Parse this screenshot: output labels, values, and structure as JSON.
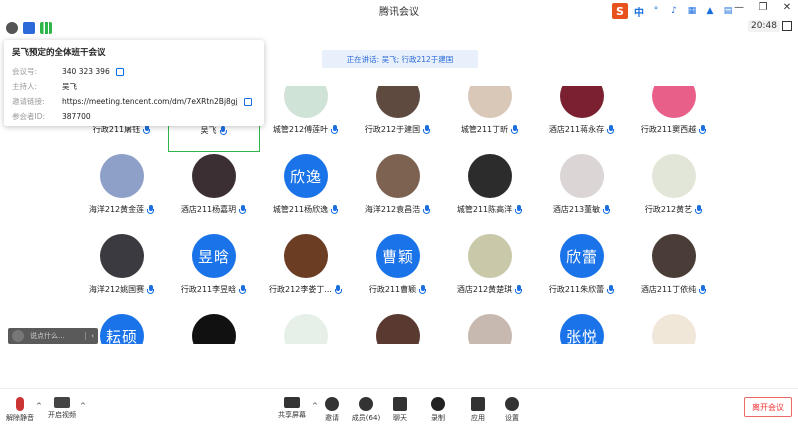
{
  "window": {
    "title": "腾讯会议",
    "minimize": "—",
    "restore": "❐",
    "close": "✕"
  },
  "ime": {
    "logo": "S",
    "lang": "中"
  },
  "status": {
    "clock": "20:48"
  },
  "meeting_info": {
    "title": "吴飞预定的全体班干会议",
    "rows": [
      {
        "label": "会议号:",
        "value": "340 323 396",
        "copy": true
      },
      {
        "label": "主持人:",
        "value": "吴飞",
        "copy": false
      },
      {
        "label": "邀请链接:",
        "value": "https://meeting.tencent.com/dm/7eXRtn2Bj8gj",
        "copy": true
      },
      {
        "label": "参会者ID:",
        "value": "387700",
        "copy": false
      }
    ]
  },
  "speaking": "正在讲话: 吴飞; 行政212于建国",
  "participants": [
    {
      "name": "行政211屠钰",
      "color": "#ccc",
      "partial": true
    },
    {
      "name": "吴飞",
      "color": "#888",
      "partial": true,
      "highlight": true
    },
    {
      "name": "城管212傅莲叶",
      "color": "#cfe3d6"
    },
    {
      "name": "行政212于建国",
      "color": "#5e4a3e"
    },
    {
      "name": "城管211丁昕",
      "color": "#d9c7b8"
    },
    {
      "name": "酒店211蒋永存",
      "color": "#7a2030"
    },
    {
      "name": "行政211窦西越",
      "color": "#e8608a"
    },
    {
      "name": "海洋212黄金莲",
      "color": "#8fa0c8"
    },
    {
      "name": "酒店211杨嘉玥",
      "color": "#3b2f33"
    },
    {
      "name": "城管211杨欣逸",
      "avatar_text": "欣逸"
    },
    {
      "name": "海洋212袁昌浩",
      "color": "#7d6252"
    },
    {
      "name": "城管211陈高洋",
      "color": "#2c2c2c"
    },
    {
      "name": "酒店213董敏",
      "color": "#dcd5d5"
    },
    {
      "name": "行政212黄艺",
      "color": "#e2e6d8"
    },
    {
      "name": "海洋212姚国赛",
      "color": "#3a3a40"
    },
    {
      "name": "行政211李昱晗",
      "avatar_text": "昱晗"
    },
    {
      "name": "行政212李娄丁...",
      "color": "#6b3e24"
    },
    {
      "name": "行政211曹颖",
      "avatar_text": "曹颖"
    },
    {
      "name": "酒店212黄楚琪",
      "color": "#c9c8a8"
    },
    {
      "name": "行政211朱欣蕾",
      "avatar_text": "欣蕾"
    },
    {
      "name": "酒店211丁依纯",
      "color": "#4a3c36"
    },
    {
      "name": "",
      "avatar_text": "耘硕"
    },
    {
      "name": "",
      "color": "#111"
    },
    {
      "name": "",
      "color": "#e6efe8"
    },
    {
      "name": "",
      "color": "#5a3a30"
    },
    {
      "name": "",
      "color": "#c8b9b0"
    },
    {
      "name": "",
      "avatar_text": "张悦"
    },
    {
      "name": "",
      "color": "#f1e7d8"
    }
  ],
  "chat": {
    "placeholder": "说点什么...",
    "arrow": "‹"
  },
  "toolbar": {
    "unmute": "解除静音",
    "video": "开启视频",
    "share": "共享屏幕",
    "invite": "邀请",
    "members": "成员(64)",
    "chat": "聊天",
    "record": "录制",
    "apps": "应用",
    "settings": "设置",
    "leave": "离开会议"
  },
  "colors": {
    "accent": "#1a73e8",
    "speaking_bg": "#e8f0fb",
    "leave_red": "#e33",
    "highlight": "#2db44a"
  }
}
